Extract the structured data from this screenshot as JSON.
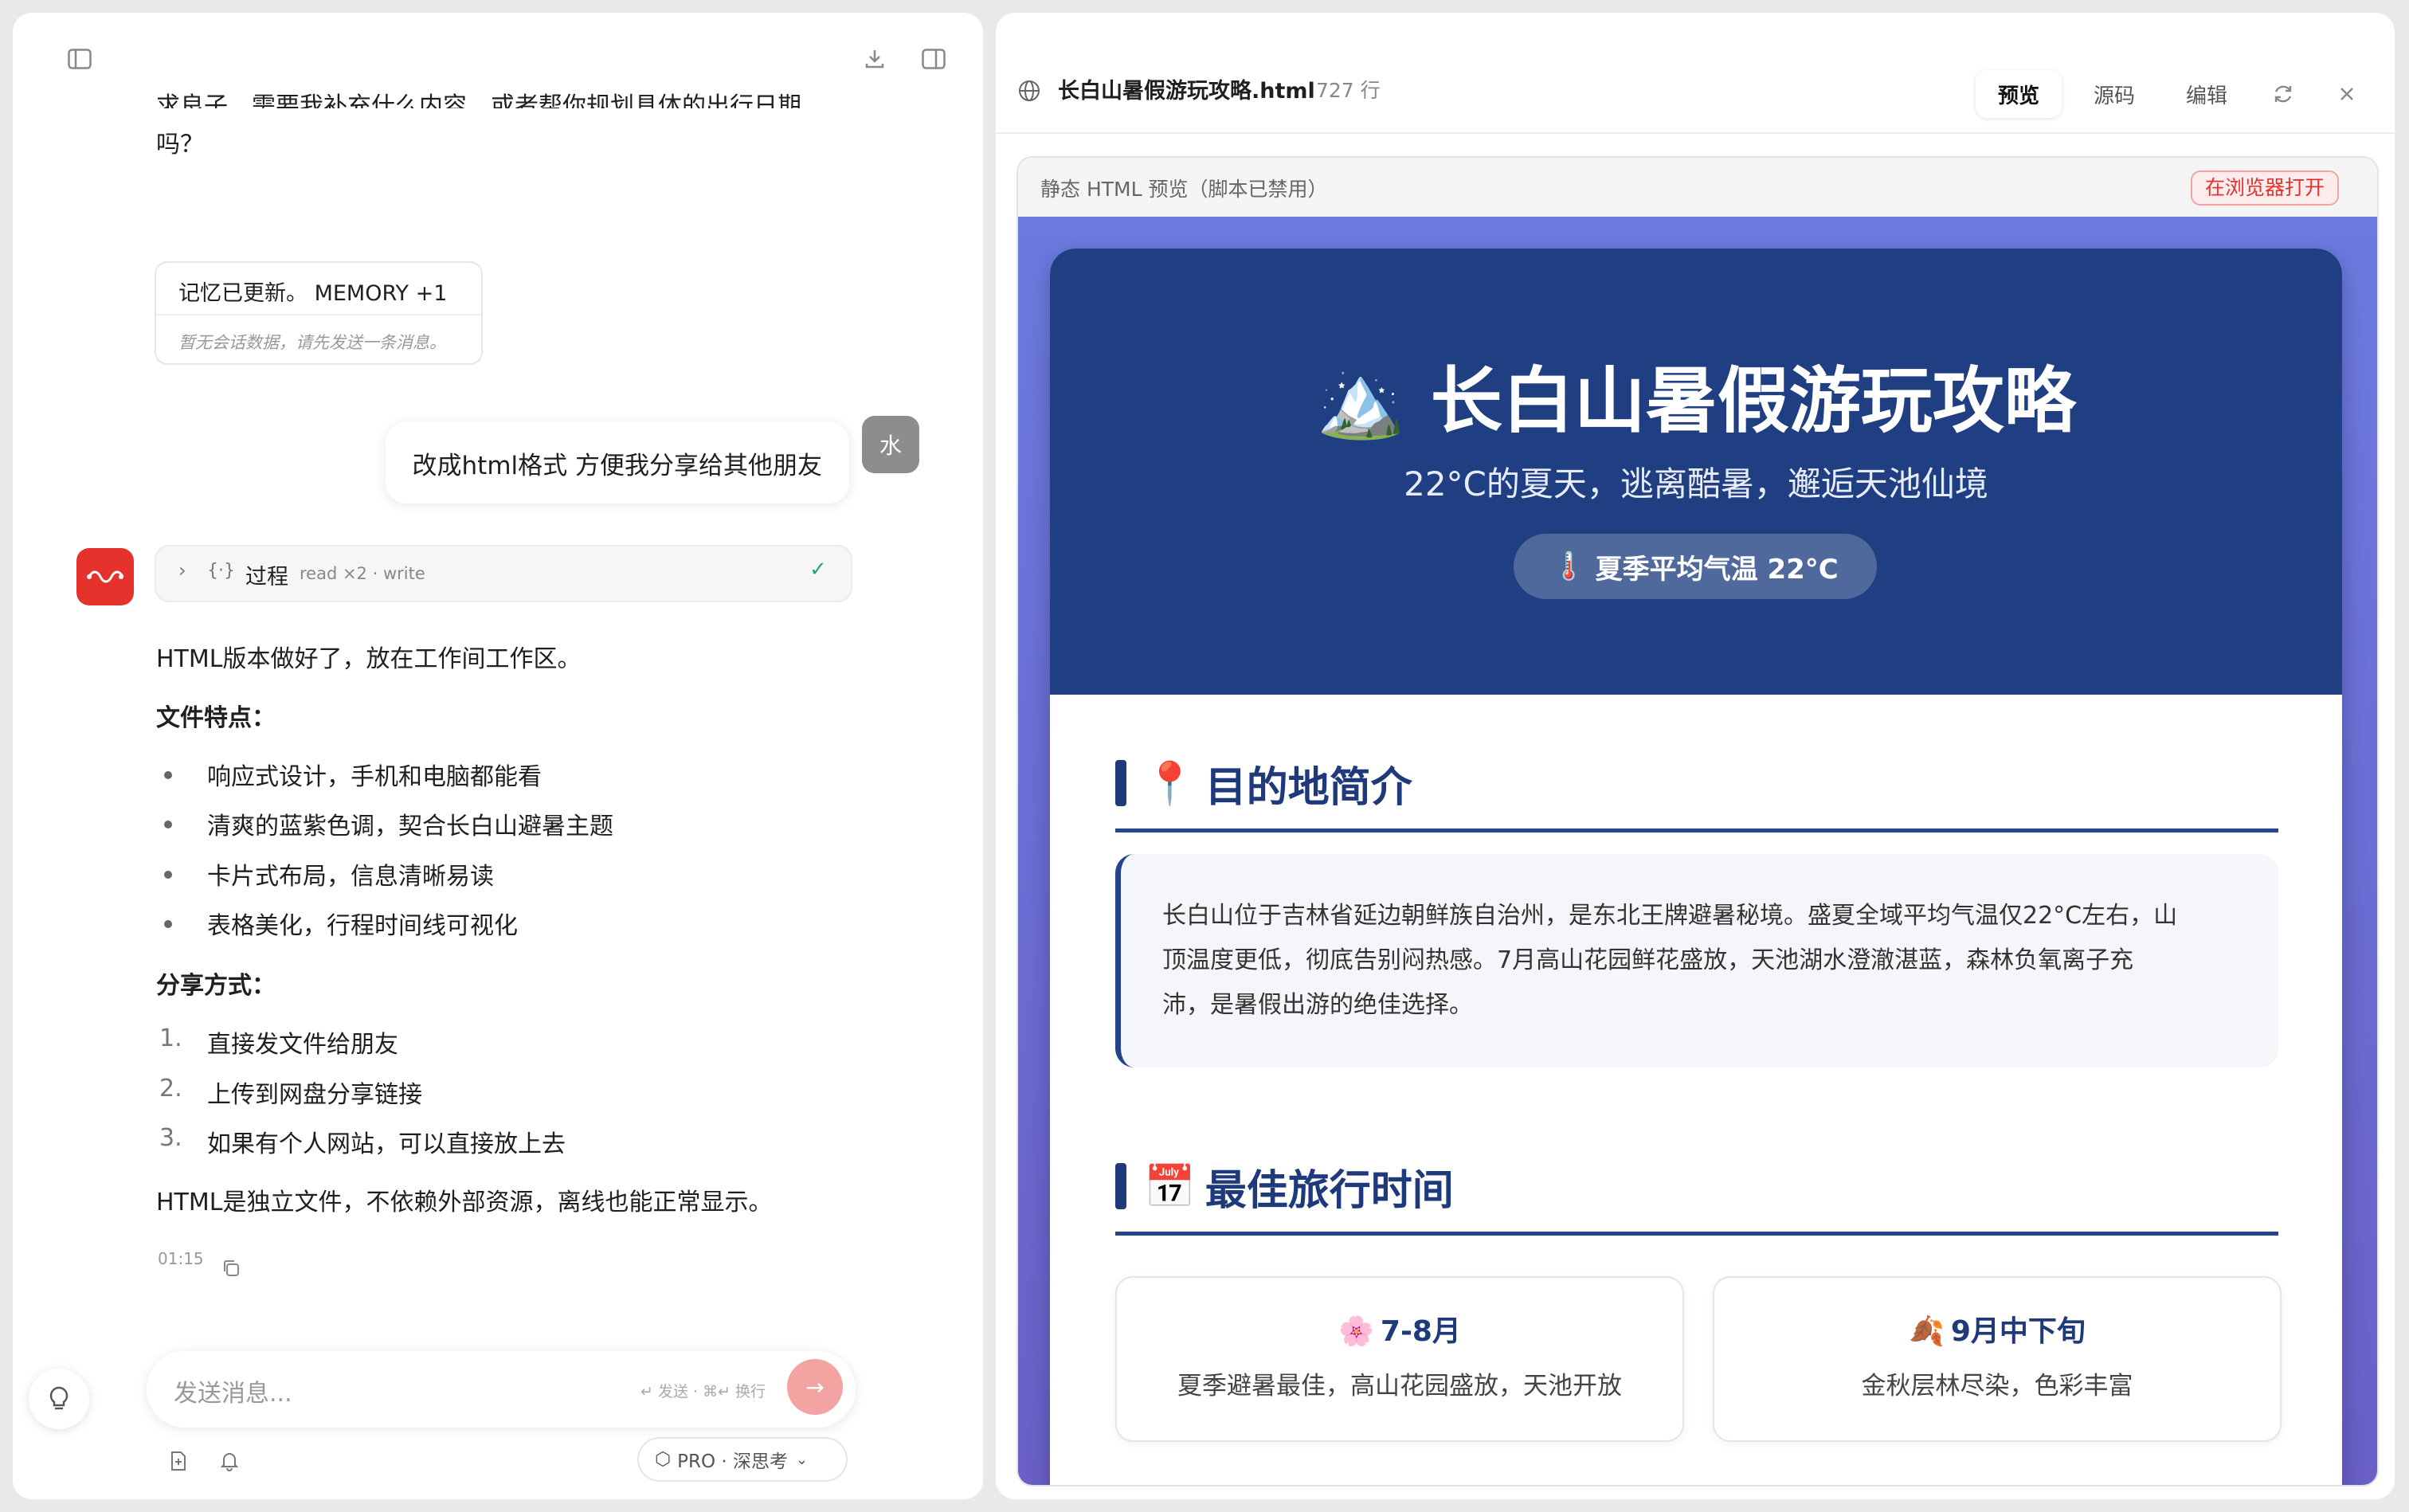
{
  "left": {
    "top_text_line1": "求良子，需要我补充什么内容，或者帮你规划具体的出行日期",
    "top_text_line2": "吗？",
    "memory": {
      "title": "记忆已更新。 MEMORY +1",
      "sub": "暂无会话数据，请先发送一条消息。"
    },
    "user_message": "改成html格式 方便我分享给其他朋友",
    "user_avatar": "水",
    "process": {
      "label": "过程",
      "detail": "read ×2 · write"
    },
    "reply": {
      "intro": "HTML版本做好了，放在工作间工作区。",
      "features_title": "文件特点：",
      "features": [
        "响应式设计，手机和电脑都能看",
        "清爽的蓝紫色调，契合长白山避暑主题",
        "卡片式布局，信息清晰易读",
        "表格美化，行程时间线可视化"
      ],
      "share_title": "分享方式：",
      "share": [
        "直接发文件给朋友",
        "上传到网盘分享链接",
        "如果有个人网站，可以直接放上去"
      ],
      "share_nums": [
        "1.",
        "2.",
        "3."
      ],
      "outro": "HTML是独立文件，不依赖外部资源，离线也能正常显示。",
      "time": "01:15"
    },
    "input": {
      "placeholder": "发送消息...",
      "hint": "↵ 发送 · ⌘↵ 换行"
    },
    "mode": "PRO · 深思考"
  },
  "right": {
    "filename": "长白山暑假游玩攻略.html",
    "lines": "727 行",
    "tabs": [
      "预览",
      "源码",
      "编辑"
    ],
    "preview_label": "静态 HTML 预览（脚本已禁用）",
    "open_browser": "在浏览器打开",
    "page": {
      "title_emoji": "🏔️",
      "title": "长白山暑假游玩攻略",
      "subtitle": "22°C的夏天，逃离酷暑，邂逅天池仙境",
      "badge_emoji": "🌡️",
      "badge": "夏季平均气温 22°C",
      "sec1_emoji": "📍",
      "sec1": "目的地简介",
      "intro": [
        "长白山位于吉林省延边朝鲜族自治州，是东北王牌避暑秘境。盛夏全域平均气温仅22°C左右，山",
        "顶温度更低，彻底告别闷热感。7月高山花园鲜花盛放，天池湖水澄澈湛蓝，森林负氧离子充",
        "沛，是暑假出游的绝佳选择。"
      ],
      "sec2_emoji": "📅",
      "sec2": "最佳旅行时间",
      "cards": [
        {
          "emoji": "🌸",
          "title": "7-8月",
          "desc": "夏季避暑最佳，高山花园盛放，天池开放"
        },
        {
          "emoji": "🍂",
          "title": "9月中下旬",
          "desc": "金秋层林尽染，色彩丰富"
        }
      ]
    }
  },
  "colors": {
    "accent": "#e5322d",
    "navy": "#1f3f82",
    "send": "#f4a3a3"
  }
}
